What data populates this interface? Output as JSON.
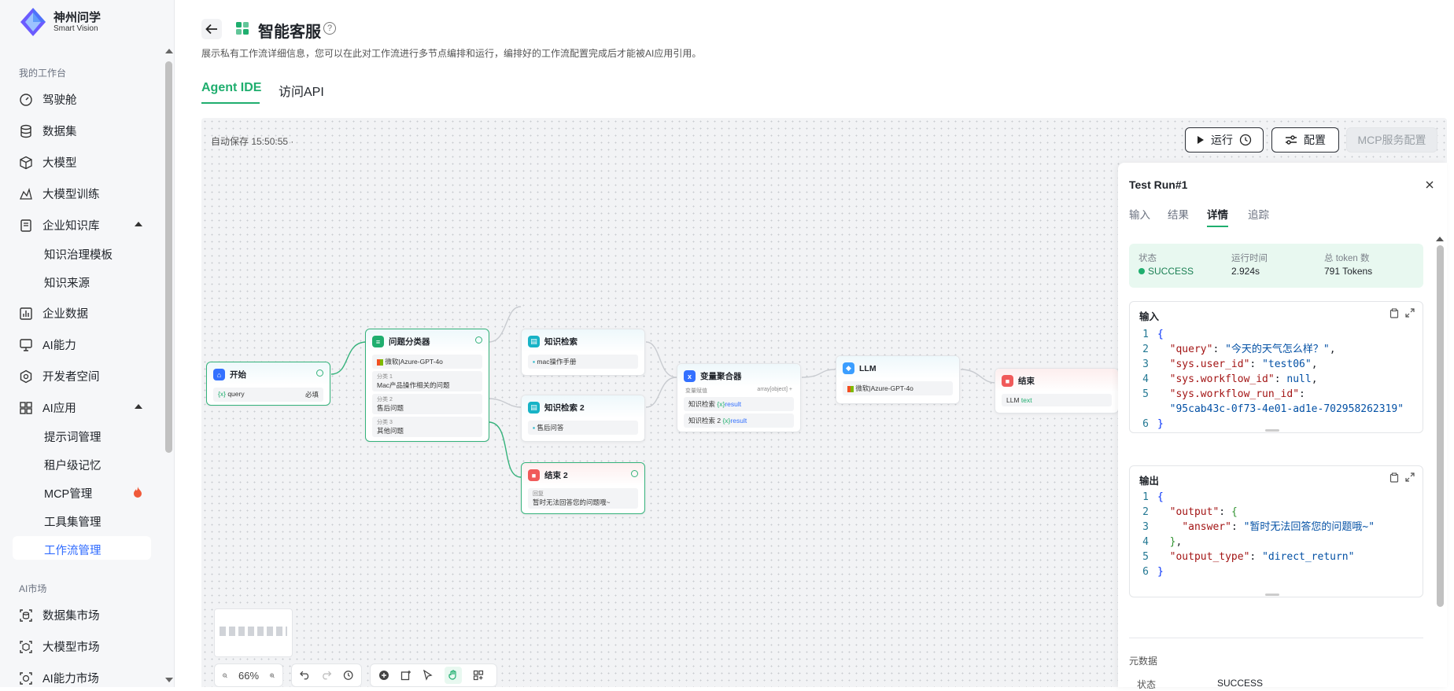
{
  "brand": {
    "name": "神州问学",
    "sub": "Smart Vision"
  },
  "sidebar": {
    "section1": "我的工作台",
    "items": [
      "驾驶舱",
      "数据集",
      "大模型",
      "大模型训练",
      "企业知识库",
      "知识治理模板",
      "知识来源",
      "企业数据",
      "AI能力",
      "开发者空间",
      "AI应用",
      "提示词管理",
      "租户级记忆",
      "MCP管理",
      "工具集管理",
      "工作流管理"
    ],
    "section2": "AI市场",
    "market": [
      "数据集市场",
      "大模型市场",
      "AI能力市场"
    ]
  },
  "page": {
    "title": "智能客服",
    "desc": "展示私有工作流详细信息，您可以在此对工作流进行多节点编排和运行，编排好的工作流配置完成后才能被AI应用引用。",
    "tabs": [
      "Agent IDE",
      "访问API"
    ]
  },
  "canvas": {
    "autosave": "自动保存 15:50:55 ·",
    "run": "运行",
    "config": "配置",
    "mcp": "MCP服务配置",
    "zoom": "66%",
    "nodes": {
      "start": {
        "title": "开始",
        "var": "query",
        "req": "必填"
      },
      "classifier": {
        "title": "问题分类器",
        "model": "微软|Azure-GPT-4o",
        "c1l": "分类 1",
        "c1": "Mac产品操作相关的问题",
        "c2l": "分类 2",
        "c2": "售后问题",
        "c3l": "分类 3",
        "c3": "其他问题"
      },
      "kb1": {
        "title": "知识检索",
        "item": "mac操作手册"
      },
      "kb2": {
        "title": "知识检索 2",
        "item": "售后问答"
      },
      "end2": {
        "title": "结束 2",
        "l": "回复",
        "v": "暂时无法回答您的问题哦~"
      },
      "agg": {
        "title": "变量聚合器",
        "h1": "变量赋值",
        "h2": "array[object]",
        "r1": "知识检索",
        "r1v": "result",
        "r2": "知识检索 2",
        "r2v": "result"
      },
      "llm": {
        "title": "LLM",
        "model": "微软|Azure-GPT-4o"
      },
      "end": {
        "title": "结束",
        "v1": "LLM",
        "v2": "text"
      }
    }
  },
  "panel": {
    "title": "Test Run#1",
    "tabs": [
      "输入",
      "结果",
      "详情",
      "追踪"
    ],
    "stats": {
      "k1": "状态",
      "v1": "SUCCESS",
      "k2": "运行时间",
      "v2": "2.924s",
      "k3": "总 token 数",
      "v3": "791 Tokens"
    },
    "input_label": "输入",
    "output_label": "输出",
    "meta_label": "元数据",
    "meta_k": "状态",
    "meta_v": "SUCCESS"
  },
  "colors": {
    "accent": "#1fae6e",
    "brand": "#2f6bff"
  }
}
